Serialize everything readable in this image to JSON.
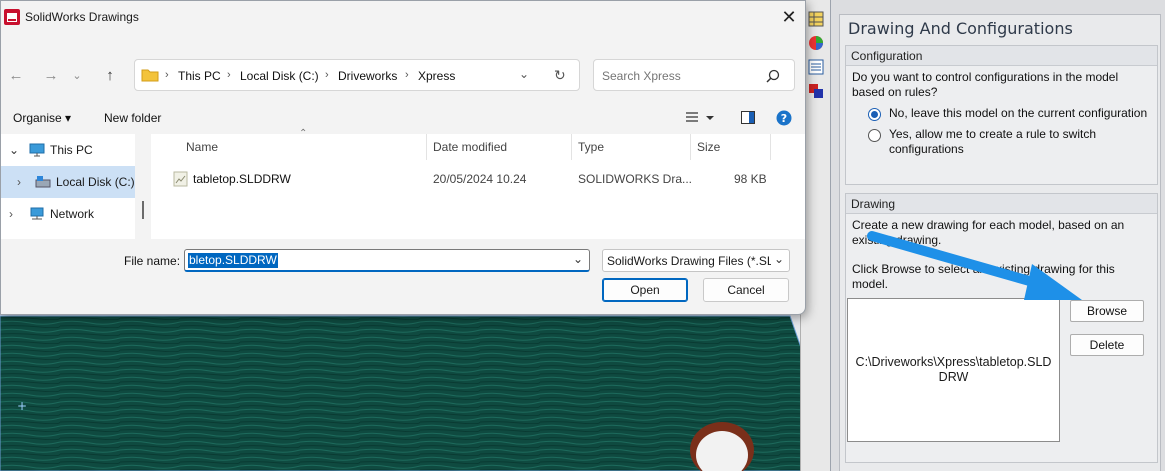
{
  "dialog": {
    "title": "SolidWorks Drawings",
    "close_glyph": "✕",
    "breadcrumbs": [
      "This PC",
      "Local Disk (C:)",
      "Driveworks",
      "Xpress"
    ],
    "search_placeholder": "Search Xpress",
    "toolbar": {
      "organise": "Organise ▾",
      "new_folder": "New folder"
    },
    "nav_items": [
      "This PC",
      "Local Disk (C:)",
      "Network"
    ],
    "columns": [
      "Name",
      "Date modified",
      "Type",
      "Size"
    ],
    "files": [
      {
        "name": "tabletop.SLDDRW",
        "date": "20/05/2024 10.24",
        "type": "SOLIDWORKS Dra...",
        "size": "98 KB"
      }
    ],
    "file_name_label": "File name:",
    "file_name_value": "bletop.SLDDRW",
    "file_type_value": "SolidWorks Drawing Files (*.SLDDRW)",
    "open_label": "Open",
    "cancel_label": "Cancel"
  },
  "panel": {
    "title": "Drawing And Configurations",
    "configuration": {
      "header": "Configuration",
      "question": "Do you want to control configurations in the model based on rules?",
      "option_no": "No, leave this model on the current configuration",
      "option_yes": "Yes, allow me to create a rule to switch configurations",
      "selected": "no"
    },
    "drawing": {
      "header": "Drawing",
      "description": "Create a new drawing for each model, based on an existing drawing.",
      "instruction": "Click Browse to select an existing drawing for this model.",
      "path": "C:\\Driveworks\\Xpress\\tabletop.SLDDRW",
      "browse_label": "Browse",
      "delete_label": "Delete"
    }
  },
  "colors": {
    "accent": "#0067c0",
    "arrow": "#1e90e8",
    "model_green": "#0f4a40"
  }
}
